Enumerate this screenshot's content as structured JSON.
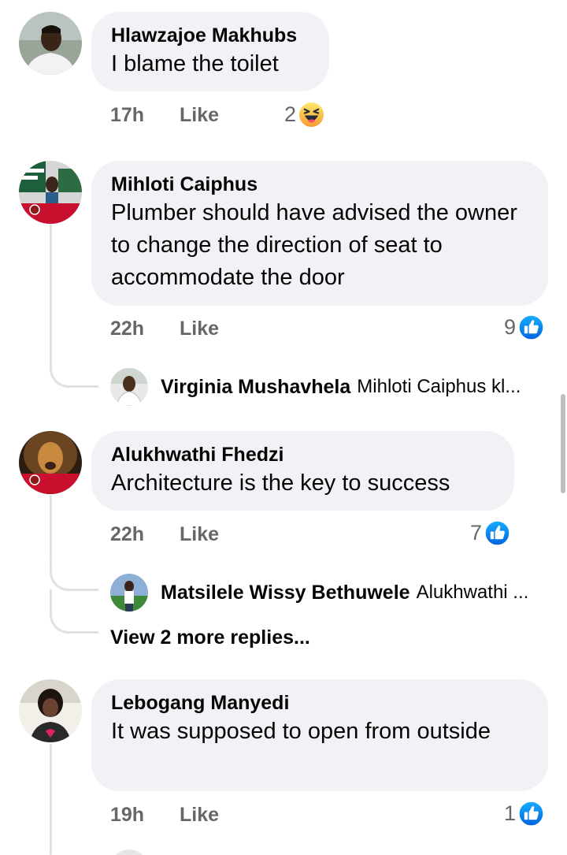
{
  "comments": [
    {
      "author": "Hlawzajoe Makhubs",
      "text": "I blame the toilet",
      "time": "17h",
      "like_label": "Like",
      "reaction_count": "2",
      "reaction_icon": "haha-emoji-icon"
    },
    {
      "author": "Mihloti Caiphus",
      "text": "Plumber should have advised the owner to change the direction of seat to accommodate the door",
      "time": "22h",
      "like_label": "Like",
      "reaction_count": "9",
      "reaction_icon": "thumbs-up-icon",
      "reply": {
        "author": "Virginia Mushavhela",
        "snippet": "Mihloti Caiphus kl..."
      }
    },
    {
      "author": "Alukhwathi Fhedzi",
      "text": "Architecture is the key to success",
      "time": "22h",
      "like_label": "Like",
      "reaction_count": "7",
      "reaction_icon": "thumbs-up-icon",
      "reply": {
        "author": "Matsilele Wissy Bethuwele",
        "snippet": "Alukhwathi ..."
      },
      "more_replies": "View 2 more replies..."
    },
    {
      "author": "Lebogang Manyedi",
      "text": "It was supposed to open from outside",
      "time": "19h",
      "like_label": "Like",
      "reaction_count": "1",
      "reaction_icon": "thumbs-up-icon"
    }
  ],
  "colors": {
    "bubble": "#f0f2f5",
    "meta_text": "#65676b",
    "like_blue": "#1877f2",
    "haha_yellow": "#f7b928",
    "thread_line": "#dfe1e5"
  }
}
